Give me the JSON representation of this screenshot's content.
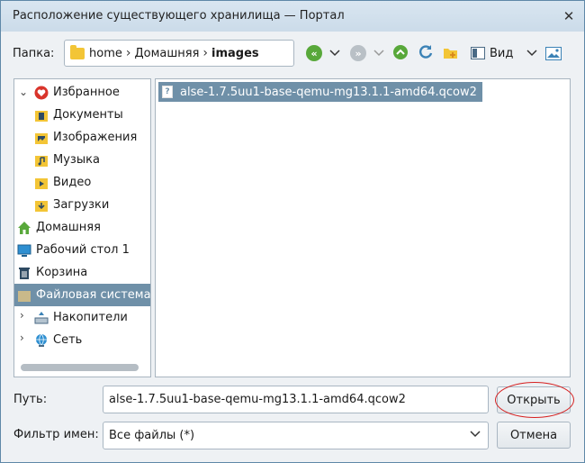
{
  "window": {
    "title": "Расположение существующего хранилища — Портал",
    "close_glyph": "✕"
  },
  "location": {
    "label": "Папка:",
    "crumbs": [
      "home",
      "Домашняя",
      "images"
    ]
  },
  "toolbar": {
    "view_label": "Вид"
  },
  "places": {
    "items": [
      {
        "label": "Избранное"
      },
      {
        "label": "Документы"
      },
      {
        "label": "Изображения"
      },
      {
        "label": "Музыка"
      },
      {
        "label": "Видео"
      },
      {
        "label": "Загрузки"
      },
      {
        "label": "Домашняя"
      },
      {
        "label": "Рабочий стол 1"
      },
      {
        "label": "Корзина"
      },
      {
        "label": "Файловая система"
      },
      {
        "label": "Накопители"
      },
      {
        "label": "Сеть"
      }
    ]
  },
  "files": {
    "items": [
      {
        "name": "alse-1.7.5uu1-base-qemu-mg13.1.1-amd64.qcow2"
      }
    ]
  },
  "path": {
    "label": "Путь:",
    "value": "alse-1.7.5uu1-base-qemu-mg13.1.1-amd64.qcow2"
  },
  "filter": {
    "label": "Фильтр имен:",
    "selected": "Все файлы (*)"
  },
  "buttons": {
    "open_label": "Открыть",
    "cancel_label": "Отмена"
  },
  "colors": {
    "selection": "#6f90a8",
    "highlight_ring": "#d62020",
    "back_icon": "#58a83a",
    "refresh_icon": "#3b82b6"
  }
}
